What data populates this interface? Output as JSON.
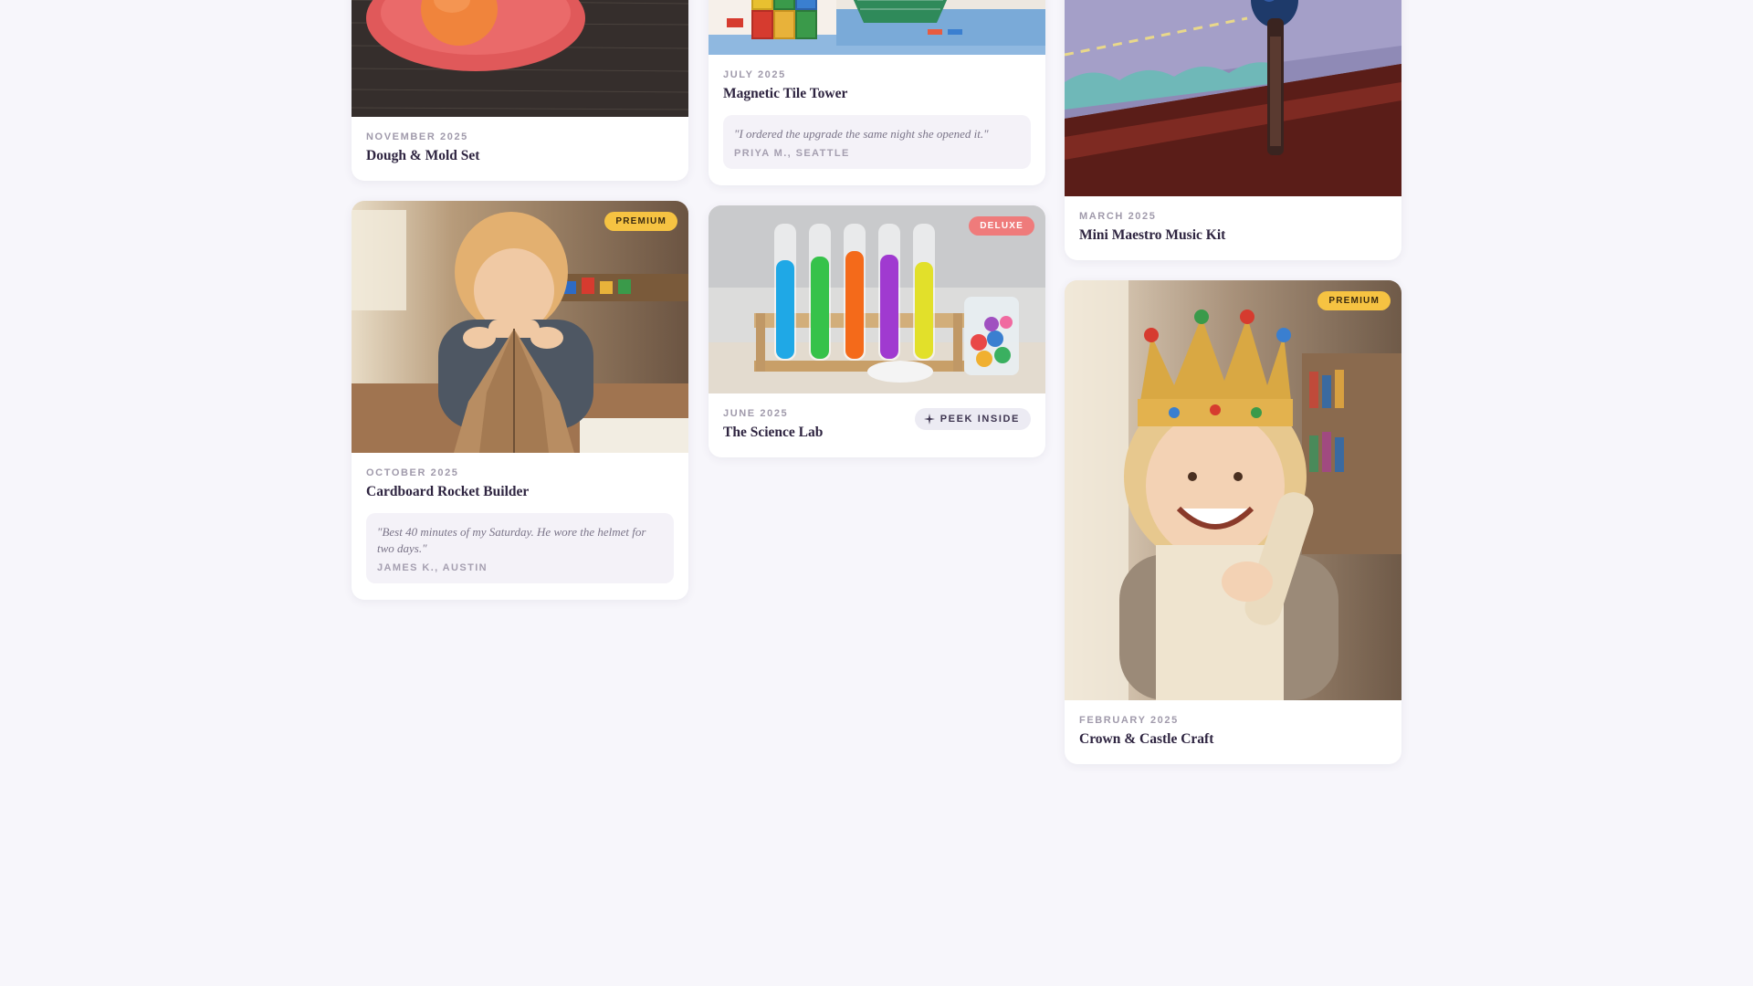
{
  "cards": [
    {
      "month": "NOVEMBER 2025",
      "title": "Dough & Mold Set"
    },
    {
      "month": "OCTOBER 2025",
      "title": "Cardboard Rocket Builder",
      "badge": "PREMIUM",
      "quote": {
        "text": "\"Best 40 minutes of my Saturday. He wore the helmet for two days.\"",
        "author": "JAMES K., AUSTIN"
      }
    },
    {
      "month": "JULY 2025",
      "title": "Magnetic Tile Tower",
      "quote": {
        "text": "\"I ordered the upgrade the same night she opened it.\"",
        "author": "PRIYA M., SEATTLE"
      }
    },
    {
      "month": "JUNE 2025",
      "title": "The Science Lab",
      "badge": "DELUXE",
      "peek_label": "PEEK INSIDE"
    },
    {
      "month": "MARCH 2025",
      "title": "Mini Maestro Music Kit"
    },
    {
      "month": "FEBRUARY 2025",
      "title": "Crown & Castle Craft",
      "badge": "PREMIUM"
    }
  ],
  "colors": {
    "background": "#f7f6fb",
    "premium_badge": "#f6c342",
    "deluxe_badge": "#ef7b7b",
    "title_text": "#2e2440"
  },
  "icons": {
    "peek": "sparkle-icon"
  }
}
